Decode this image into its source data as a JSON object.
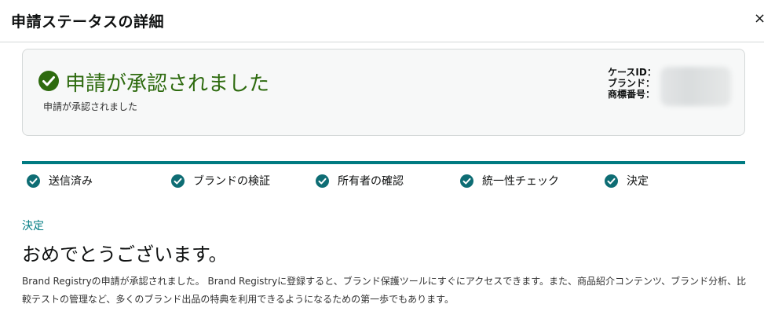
{
  "modal": {
    "title": "申請ステータスの詳細",
    "close_label": "×"
  },
  "status": {
    "icon": "check-circle-icon",
    "title": "申請が承認されました",
    "subtitle": "申請が承認されました",
    "meta_labels": {
      "case_id": "ケースID：",
      "brand": "ブランド：",
      "trademark_number": "商標番号："
    }
  },
  "steps": [
    {
      "label": "送信済み",
      "icon": "check-circle-icon"
    },
    {
      "label": "ブランドの検証",
      "icon": "check-circle-icon"
    },
    {
      "label": "所有者の確認",
      "icon": "check-circle-icon"
    },
    {
      "label": "統一性チェック",
      "icon": "check-circle-icon"
    },
    {
      "label": "決定",
      "icon": "check-circle-icon"
    }
  ],
  "decision": {
    "label": "決定",
    "heading": "おめでとうございます。",
    "body": "Brand Registryの申請が承認されました。 Brand Registryに登録すると、ブランド保護ツールにすぐにアクセスできます。また、商品紹介コンテンツ、ブランド分析、比較テストの管理など、多くのブランド出品の特典を利用できるようになるための第一歩でもあります。"
  },
  "colors": {
    "approved_green": "#2d6a0e",
    "teal_accent": "#007b82",
    "step_check": "#0e6d74"
  }
}
